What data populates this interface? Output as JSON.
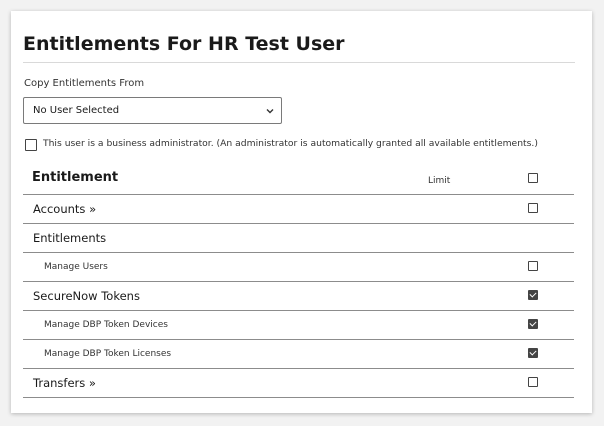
{
  "page": {
    "title": "Entitlements For HR Test User"
  },
  "copy": {
    "label": "Copy Entitlements From",
    "selected": "No User Selected"
  },
  "admin": {
    "checked": false,
    "text": "This user is a business administrator. (An administrator is automatically granted all available entitlements.)"
  },
  "table": {
    "header": {
      "entitlement": "Entitlement",
      "limit": "Limit",
      "all_checked": false
    },
    "rows": [
      {
        "label": "Accounts »",
        "level": 1,
        "has_checkbox": true,
        "checked": false
      },
      {
        "label": "Entitlements",
        "level": 1,
        "has_checkbox": false,
        "checked": false
      },
      {
        "label": "Manage Users",
        "level": 2,
        "has_checkbox": true,
        "checked": false
      },
      {
        "label": "SecureNow Tokens",
        "level": 1,
        "has_checkbox": true,
        "checked": true
      },
      {
        "label": "Manage DBP Token Devices",
        "level": 2,
        "has_checkbox": true,
        "checked": true
      },
      {
        "label": "Manage DBP Token Licenses",
        "level": 2,
        "has_checkbox": true,
        "checked": true
      },
      {
        "label": "Transfers »",
        "level": 1,
        "has_checkbox": true,
        "checked": false
      }
    ]
  },
  "icons": {
    "select_chevron": "chevron-down-icon",
    "checkbox": "checkbox-icon"
  },
  "colors": {
    "checkbox_fill": "#444444",
    "divider": "#8c8c8c",
    "panel_bg": "#ffffff",
    "page_bg": "#f2f2f2"
  }
}
